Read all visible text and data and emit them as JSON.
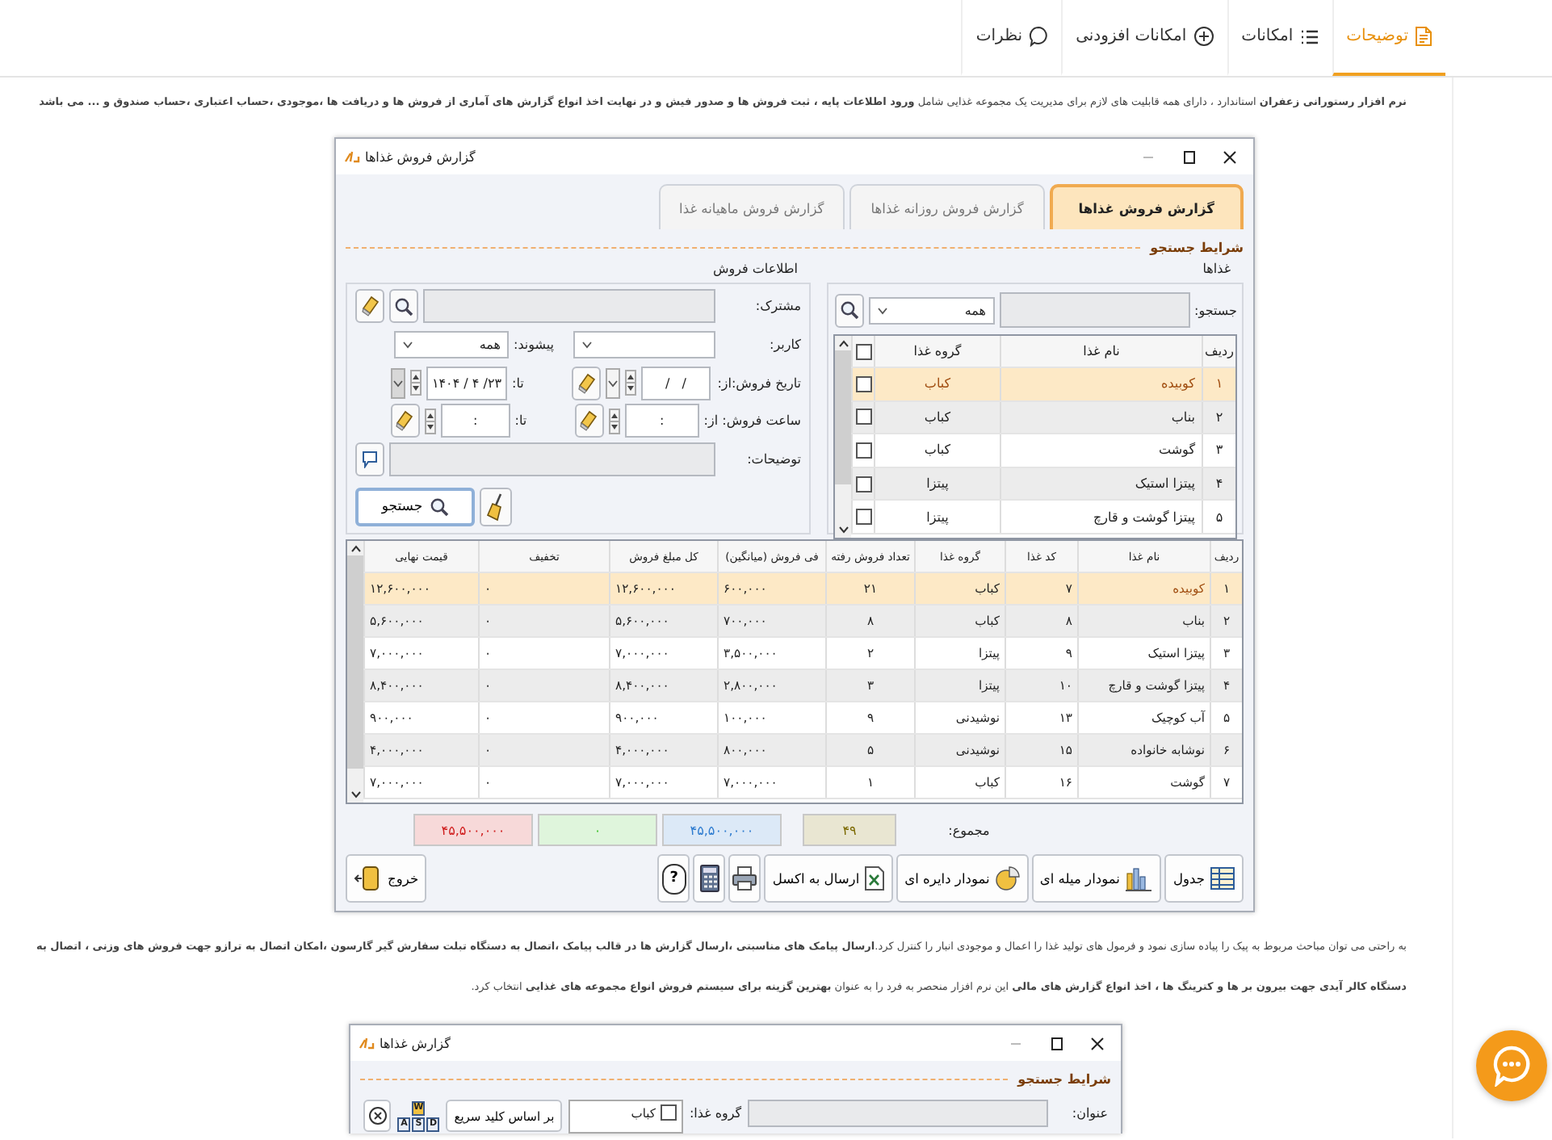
{
  "nav_tabs": [
    {
      "label": "توضیحات",
      "selected": true
    },
    {
      "label": "امکانات",
      "selected": false
    },
    {
      "label": "امکانات افزودنی",
      "selected": false
    },
    {
      "label": "نظرات",
      "selected": false
    }
  ],
  "intro": "**نرم افزار رستورانی زعفران** استاندارد ، دارای همه قابلیت های لازم برای مدیریت یک مجموعه غذایی شامل **ورود اطلاعات پایه ، ثبت فروش ها و صدور فیش و در نهایت اخذ انواع گزارش های آماری از فروش ها و دریافت ها ،موجودی ،حساب اعتباری ،حساب صندوق و ...  می باشد**",
  "report_window": {
    "title": "گزارش فروش غذاها",
    "tabs": [
      {
        "label": "گزارش فروش غذاها",
        "selected": true
      },
      {
        "label": "گزارش فروش روزانه غذاها",
        "selected": false
      },
      {
        "label": "گزارش فروش ماهیانه غذا",
        "selected": false
      }
    ],
    "section_title": "شرایط جستجو",
    "foods_panel": {
      "title": "غذاها",
      "search_label": "جستجو:",
      "filter": "همه",
      "columns": [
        "ردیف",
        "نام غذا",
        "گروه غذا"
      ],
      "header_checked": false,
      "rows": [
        {
          "row": "۱",
          "name": "کوبیده",
          "group": "کباب",
          "checked": false,
          "selected": true
        },
        {
          "row": "۲",
          "name": "بناب",
          "group": "کباب",
          "checked": false,
          "selected": false
        },
        {
          "row": "۳",
          "name": "گوشت",
          "group": "کباب",
          "checked": false,
          "selected": false
        },
        {
          "row": "۴",
          "name": "پیتزا استیک",
          "group": "پیتزا",
          "checked": false,
          "selected": false
        },
        {
          "row": "۵",
          "name": "پیتزا گوشت و قارچ",
          "group": "پیتزا",
          "checked": false,
          "selected": false
        }
      ]
    },
    "sales_panel": {
      "title": "اطلاعات فروش",
      "customer_label": "مشترک:",
      "user_label": "کاربر:",
      "prefix_label": "پیشوند:",
      "prefix_value": "همه",
      "date_label": "تاریخ فروش:",
      "date_from_label": "از:",
      "date_from": "/   /",
      "date_to_label": "تا:",
      "date_to": "۱۴۰۴ / ۴ /۲۳",
      "time_label": "ساعت فروش: از:",
      "time_from": ":",
      "time_to_label": "تا:",
      "time_to": ":",
      "notes_label": "توضیحات:",
      "search_button": "جستجو"
    },
    "sales_table": {
      "columns": [
        "ردیف",
        "نام غذا",
        "کد غذا",
        "گروه غذا",
        "تعداد فروش رفته",
        "فی فروش (میانگین)",
        "کل مبلغ فروش",
        "تخفیف",
        "قیمت نهایی"
      ],
      "rows": [
        {
          "selected": true,
          "cells": [
            "۱",
            "کوبیده",
            "۷",
            "کباب",
            "۲۱",
            "۶۰۰,۰۰۰",
            "۱۲,۶۰۰,۰۰۰",
            "۰",
            "۱۲,۶۰۰,۰۰۰"
          ]
        },
        {
          "selected": false,
          "cells": [
            "۲",
            "بناب",
            "۸",
            "کباب",
            "۸",
            "۷۰۰,۰۰۰",
            "۵,۶۰۰,۰۰۰",
            "۰",
            "۵,۶۰۰,۰۰۰"
          ]
        },
        {
          "selected": false,
          "cells": [
            "۳",
            "پیتزا استیک",
            "۹",
            "پیتزا",
            "۲",
            "۳,۵۰۰,۰۰۰",
            "۷,۰۰۰,۰۰۰",
            "۰",
            "۷,۰۰۰,۰۰۰"
          ]
        },
        {
          "selected": false,
          "cells": [
            "۴",
            "پیتزا گوشت و قارچ",
            "۱۰",
            "پیتزا",
            "۳",
            "۲,۸۰۰,۰۰۰",
            "۸,۴۰۰,۰۰۰",
            "۰",
            "۸,۴۰۰,۰۰۰"
          ]
        },
        {
          "selected": false,
          "cells": [
            "۵",
            "آب کوچیک",
            "۱۳",
            "نوشیدنی",
            "۹",
            "۱۰۰,۰۰۰",
            "۹۰۰,۰۰۰",
            "۰",
            "۹۰۰,۰۰۰"
          ]
        },
        {
          "selected": false,
          "cells": [
            "۶",
            "نوشابه خانواده",
            "۱۵",
            "نوشیدنی",
            "۵",
            "۸۰۰,۰۰۰",
            "۴,۰۰۰,۰۰۰",
            "۰",
            "۴,۰۰۰,۰۰۰"
          ]
        },
        {
          "selected": false,
          "cells": [
            "۷",
            "گوشت",
            "۱۶",
            "کباب",
            "۱",
            "۷,۰۰۰,۰۰۰",
            "۷,۰۰۰,۰۰۰",
            "۰",
            "۷,۰۰۰,۰۰۰"
          ]
        }
      ]
    },
    "totals": {
      "label": "مجموع:",
      "items": [
        {
          "value": "۴۹",
          "color": "#e9e6d2"
        },
        {
          "value": "۴۵,۵۰۰,۰۰۰",
          "color": "#dce9f7"
        },
        {
          "value": "۰",
          "color": "#dff5dc"
        },
        {
          "value": "۴۵,۵۰۰,۰۰۰",
          "color": "#f7d9d9"
        }
      ]
    },
    "buttons": [
      {
        "kind": "table",
        "label": "جدول"
      },
      {
        "kind": "bar-chart",
        "label": "نمودار میله ای"
      },
      {
        "kind": "pie-chart",
        "label": "نمودار دایره ای"
      },
      {
        "kind": "excel",
        "label": "ارسال به اکسل"
      },
      {
        "kind": "printer"
      },
      {
        "kind": "calculator"
      },
      {
        "kind": "help",
        "label": "?"
      },
      {
        "kind": "exit",
        "label": "خروج"
      }
    ]
  },
  "details": "به راحتی می توان مباحث مربوط به پیک را پیاده سازی نمود و فرمول های تولید غذا را اعمال و موجودی انبار را کنترل کرد.**ارسال پیامک های مناسبتی ،ارسال گزارش ها در قالب پیامک ،اتصال به دستگاه تبلت سفارش گیر گارسون ،امکان اتصال به ترازو جهت فروش های وزنی ، اتصال به دستگاه کالر آیدی جهت بیرون بر ها و کترینگ ها ، اخذ انواع گزارش های مالی** این نرم افزار منحصر به فرد را به عنوان **بهترین گزینه برای سیستم فروش انواع مجموعه های غذایی** انتخاب کرد.",
  "foods_window": {
    "title": "گزارش غذاها",
    "section_title": "شرایط جستجو",
    "title_label": "عنوان:",
    "group_label": "گروه غذا:",
    "groups": [
      {
        "label": "کباب",
        "checked": false
      }
    ],
    "shortcut_button": "بر اساس کلید سریع",
    "shortcut_keys": [
      "W",
      "D",
      "S",
      "A"
    ]
  }
}
